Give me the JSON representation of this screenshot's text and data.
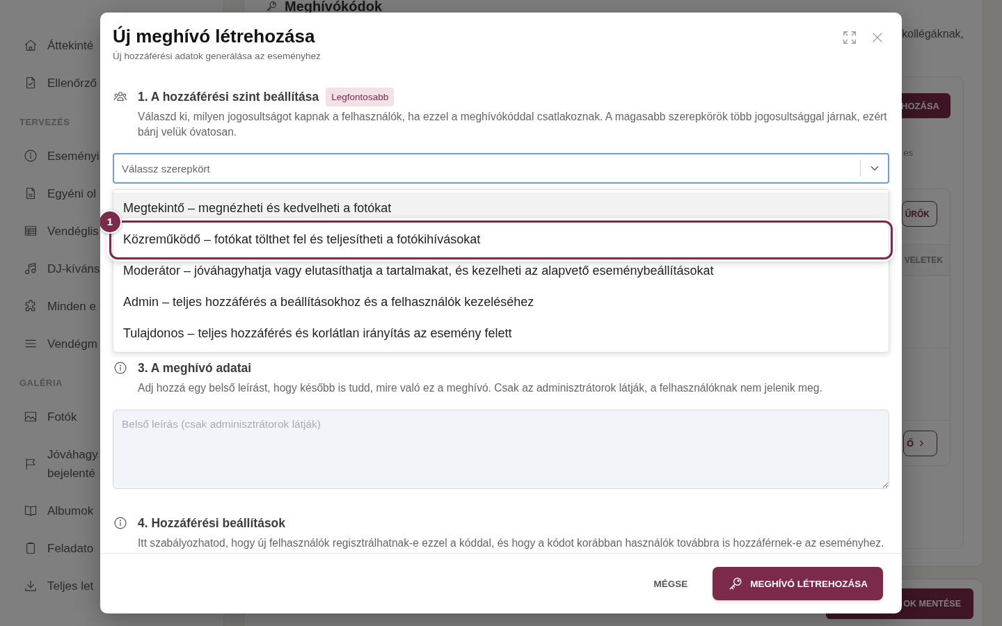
{
  "sidebar": {
    "groups": [
      {
        "items": [
          "Áttekinté",
          "Ellenőrző"
        ]
      },
      {
        "title": "TERVEZÉS",
        "items": [
          "Eseményi",
          "Egyéni ol",
          "Vendéglis",
          "DJ-kíváns",
          "Minden e",
          "Vendégm"
        ]
      },
      {
        "title": "GALÉRIA",
        "items": [
          "Fotók",
          "Jóváhagy\nbejelenté",
          "Albumok",
          "Feladato",
          "Teljes let"
        ]
      }
    ]
  },
  "page": {
    "title": "Meghívókódok",
    "intro_text": "kollégáknak,",
    "card_button": "HOZÁSA",
    "helper_text": "es",
    "toolbar_button": "ŰRŐK",
    "column_header": "VELETEK",
    "footer_button": "Ő",
    "bottom_button": "OK MENTÉSE"
  },
  "dialog": {
    "title": "Új meghívó létrehozása",
    "subtitle": "Új hozzáférési adatok generálása az eseményhez",
    "sections": [
      {
        "heading": "1. A hozzáférési szint beállítása",
        "badge": "Legfontosabb",
        "description": "Válaszd ki, milyen jogosultságot kapnak a felhasználók, ha ezzel a meghívókóddal csatlakoznak. A magasabb szerepkörök több jogosultsággal járnak, ezért bánj velük óvatosan.",
        "select": {
          "placeholder": "Válassz szerepkört",
          "expanded": true,
          "callout_label": "1",
          "options": [
            {
              "label": "Megtekintő – megnézheti és kedvelheti a fotókat",
              "highlighted": true,
              "annotated": false
            },
            {
              "label": "Közreműködő – fotókat tölthet fel és teljesítheti a fotókihívásokat",
              "highlighted": false,
              "annotated": true
            },
            {
              "label": "Moderátor – jóváhagyhatja vagy elutasíthatja a tartalmakat, és kezelheti az alapvető eseménybeállításokat",
              "highlighted": false,
              "annotated": false
            },
            {
              "label": "Admin – teljes hozzáférés a beállításokhoz és a felhasználók kezeléséhez",
              "highlighted": false,
              "annotated": false
            },
            {
              "label": "Tulajdonos – teljes hozzáférés és korlátlan irányítás az esemény felett",
              "highlighted": false,
              "annotated": false
            }
          ]
        }
      },
      {
        "heading": "3. A meghívó adatai",
        "description": "Adj hozzá egy belső leírást, hogy később is tudd, mire való ez a meghívó. Csak az adminisztrátorok látják, a felhasználóknak nem jelenik meg.",
        "textarea": {
          "placeholder": "Belső leírás (csak adminisztrátorok látják)"
        }
      },
      {
        "heading": "4. Hozzáférési beállítások",
        "description": "Itt szabályozhatod, hogy új felhasználók regisztrálhatnak-e ezzel a kóddal, és hogy a kódot korábban használók továbbra is hozzáférnek-e az eseményhez."
      }
    ],
    "buttons": [
      {
        "label": "MÉGSE",
        "kind": "text"
      },
      {
        "label": "MEGHÍVÓ LÉTREHOZÁSA",
        "kind": "primary"
      }
    ]
  }
}
